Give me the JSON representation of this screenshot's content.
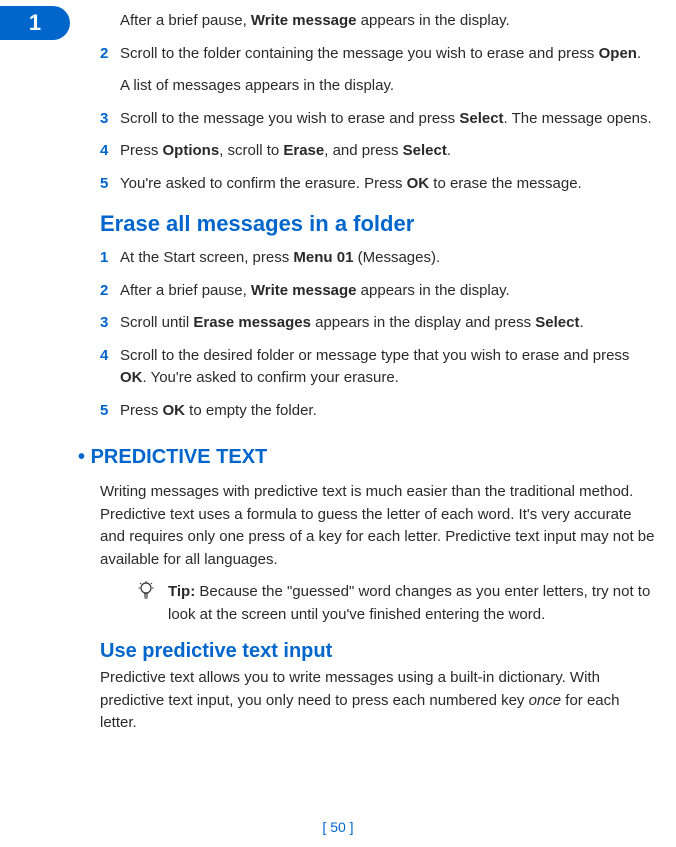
{
  "tab": {
    "number": "1"
  },
  "stepsA": [
    {
      "num": "",
      "html": "After a brief pause, <b>Write message</b> appears in the display."
    },
    {
      "num": "2",
      "html": "Scroll to the folder containing the message you wish to erase and press <b>Open</b>."
    },
    {
      "note": "A list of messages appears in the display."
    },
    {
      "num": "3",
      "html": "Scroll to the message you wish to erase and press <b>Select</b>. The message opens."
    },
    {
      "num": "4",
      "html": "Press <b>Options</b>, scroll to <b>Erase</b>, and press <b>Select</b>."
    },
    {
      "num": "5",
      "html": "You're asked to confirm the erasure. Press <b>OK</b> to erase the message."
    }
  ],
  "heading1": "Erase all messages in a folder",
  "stepsB": [
    {
      "num": "1",
      "html": "At the Start screen, press <b>Menu 01</b> (Messages)."
    },
    {
      "num": "2",
      "html": "After a brief pause, <b>Write message</b> appears in the display."
    },
    {
      "num": "3",
      "html": "Scroll until <b>Erase messages</b> appears in the display and press <b>Select</b>."
    },
    {
      "num": "4",
      "html": "Scroll to the desired folder or message type that you wish to erase and press <b>OK</b>. You're asked to confirm your erasure."
    },
    {
      "num": "5",
      "html": "Press <b>OK</b> to empty the folder."
    }
  ],
  "section": {
    "bullet": "•",
    "title": "PREDICTIVE TEXT"
  },
  "predictive_intro": "Writing messages with predictive text is much easier than the traditional method. Predictive text uses a formula to guess the letter of each word. It's very accurate and requires only one press of a key for each letter. Predictive text input may not be available for all languages.",
  "tip": {
    "html": "<b>Tip:</b> Because the \"guessed\" word changes as you enter letters, try not to look at the screen until you've finished entering the word."
  },
  "heading2": "Use predictive text input",
  "predictive_body": "Predictive text allows you to write messages using a built-in dictionary. With predictive text input, you only need to press each numbered key <i>once</i> for each letter.",
  "page_number": "[ 50 ]"
}
